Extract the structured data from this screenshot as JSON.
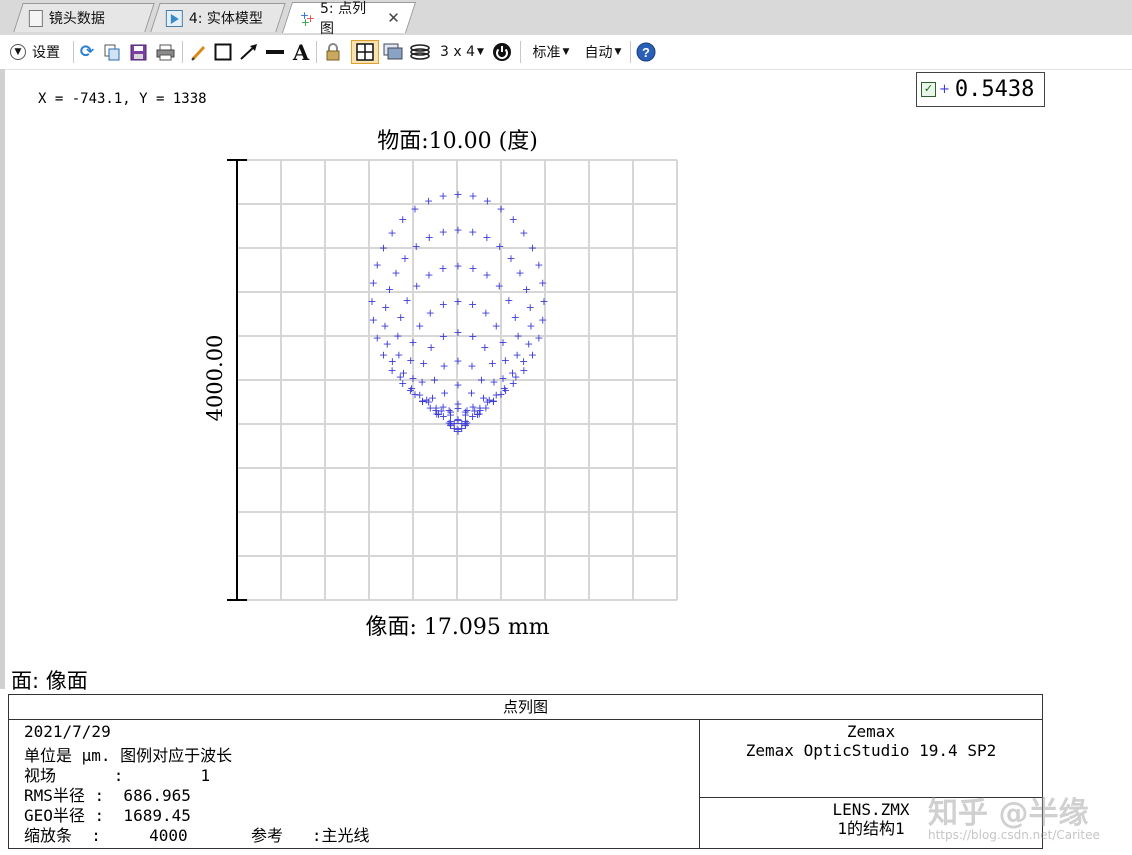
{
  "tabs": [
    {
      "label": "镜头数据",
      "icon": "document-icon"
    },
    {
      "label": "4: 实体模型",
      "icon": "solid-model-icon"
    },
    {
      "label": "5: 点列图",
      "icon": "spot-diagram-icon",
      "active": true
    }
  ],
  "toolbar": {
    "settings_label": "设置",
    "layout_label": "3 x 4",
    "standard_label": "标准",
    "auto_label": "自动"
  },
  "coords_readout": "X = -743.1, Y = 1338",
  "legend": {
    "value": "0.5438",
    "checked": true,
    "marker_color": "#3a3ad8"
  },
  "plot": {
    "title": "物面:10.00 (度)",
    "scale_bar_label": "4000.00",
    "footer": "像面: 17.095 mm",
    "spot_color": "#3a3ad8",
    "grid_color": "#d6d6d6"
  },
  "surface_label": "面: 像面",
  "info": {
    "title": "点列图",
    "date": "2021/7/29",
    "units_line": "单位是 μm. 图例对应于波长",
    "field_line": "视场      :        1",
    "rms_line": "RMS半径 :  686.965",
    "geo_line": "GEO半径 :  1689.45",
    "scale_line": "缩放条  :     4000",
    "reference_label": "参考   :主光线",
    "product_brand": "Zemax",
    "product_name": "Zemax OpticStudio 19.4 SP2",
    "file_name": "LENS.ZMX",
    "config_label": "1的结构1"
  },
  "watermark": {
    "main": "知乎 @半缘",
    "url": "https://blog.csdn.net/Caritee"
  }
}
